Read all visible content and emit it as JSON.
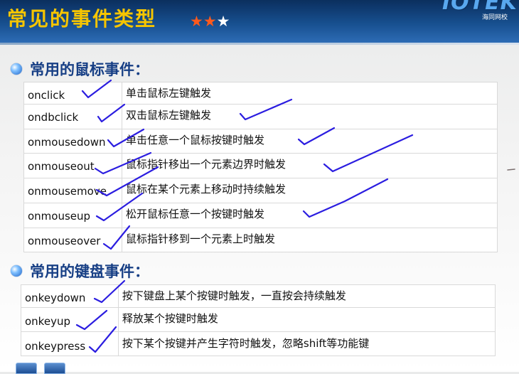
{
  "header": {
    "title": "常见的事件类型",
    "stars": [
      "★",
      "★",
      "★"
    ],
    "logo": "IOTEK",
    "logo_sub": "海同网校"
  },
  "mouse_section": {
    "title": "常用的鼠标事件：",
    "rows": [
      {
        "event": "onclick",
        "desc": "单击鼠标左键触发"
      },
      {
        "event": "ondbclick",
        "desc": "双击鼠标左键触发"
      },
      {
        "event": "onmousedown",
        "desc": "单击任意一个鼠标按键时触发"
      },
      {
        "event": "onmouseout",
        "desc": "鼠标指针移出一个元素边界时触发"
      },
      {
        "event": "onmousemove",
        "desc": "鼠标在某个元素上移动时持续触发"
      },
      {
        "event": "onmouseup",
        "desc": "松开鼠标任意一个按键时触发"
      },
      {
        "event": "onmouseover",
        "desc": "鼠标指针移到一个元素上时触发"
      }
    ]
  },
  "keyboard_section": {
    "title": "常用的键盘事件：",
    "rows": [
      {
        "event": "onkeydown",
        "desc": "按下键盘上某个按键时触发，一直按会持续触发"
      },
      {
        "event": "onkeyup",
        "desc": "释放某个按键时触发"
      },
      {
        "event": "onkeypress",
        "desc": "按下某个按键并产生字符时触发，忽略shift等功能键"
      }
    ]
  },
  "colors": {
    "header_bg": "#174f8f",
    "title": "#f6c500",
    "section_title": "#173f85",
    "check_mark": "#2b1de0"
  }
}
